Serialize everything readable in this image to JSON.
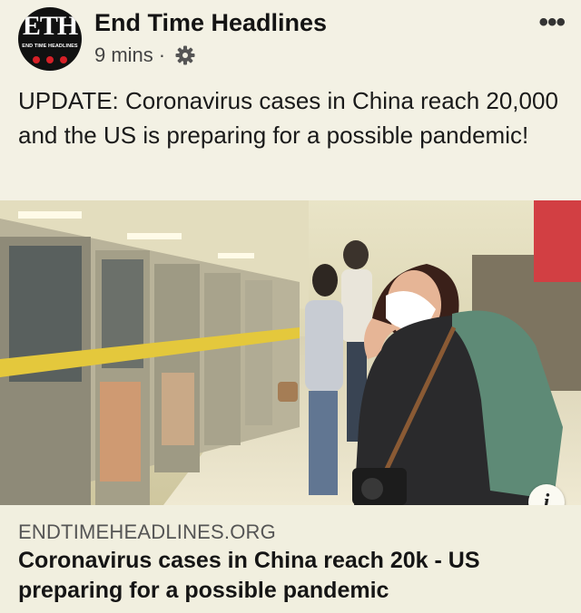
{
  "header": {
    "page_name": "End Time Headlines",
    "timestamp": "9 mins",
    "separator": "·",
    "privacy_icon": "gear-icon",
    "more_icon": "more-icon",
    "more_label": "•••"
  },
  "avatar": {
    "logo_text": "ETH",
    "logo_subtext": "END TIME HEADLINES"
  },
  "post": {
    "text": "UPDATE: Coronavirus cases in China reach 20,000 and the US is preparing for a possible pandemic!"
  },
  "link_preview": {
    "domain": "ENDTIMEHEADLINES.ORG",
    "title": "Coronavirus cases in China reach 20k - US preparing for a possible pandemic",
    "info_label": "i"
  },
  "colors": {
    "background": "#f3f1e4",
    "logo_red": "#d62027"
  }
}
